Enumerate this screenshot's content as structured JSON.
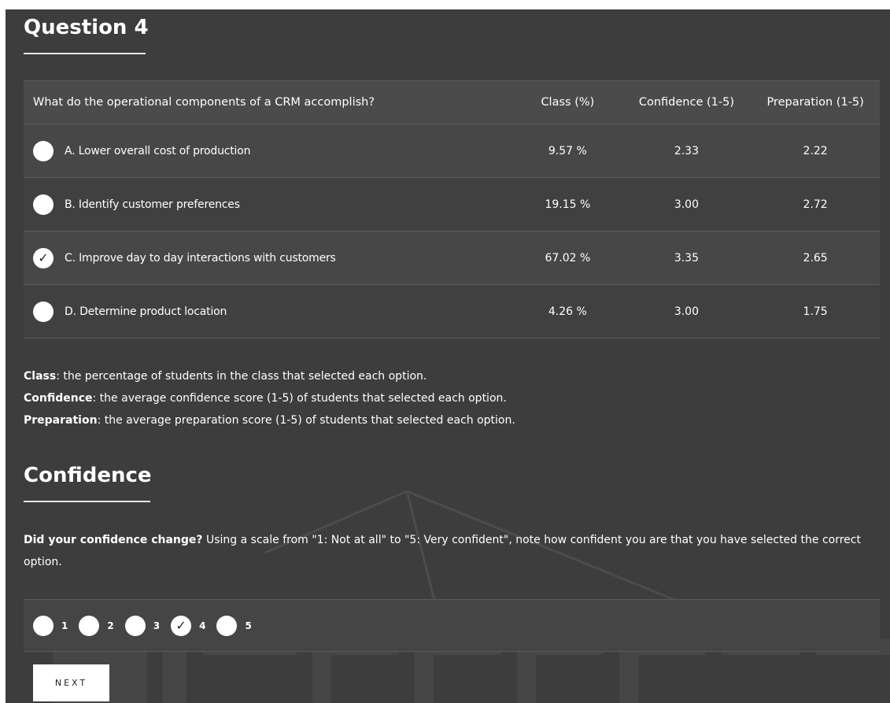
{
  "question": {
    "title": "Question 4",
    "text": "What do the operational components of a CRM accomplish?"
  },
  "table": {
    "columns": [
      "Class (%)",
      "Confidence (1-5)",
      "Preparation (1-5)"
    ],
    "rows": [
      {
        "label": "A. Lower overall cost of production",
        "class": "9.57 %",
        "confidence": "2.33",
        "preparation": "2.22",
        "selected": false
      },
      {
        "label": "B. Identify customer preferences",
        "class": "19.15 %",
        "confidence": "3.00",
        "preparation": "2.72",
        "selected": false
      },
      {
        "label": "C. Improve day to day interactions with customers",
        "class": "67.02 %",
        "confidence": "3.35",
        "preparation": "2.65",
        "selected": true
      },
      {
        "label": "D. Determine product location",
        "class": "4.26 %",
        "confidence": "3.00",
        "preparation": "1.75",
        "selected": false
      }
    ]
  },
  "legend": {
    "class_term": "Class",
    "class_desc": ": the percentage of students in the class that selected each option.",
    "confidence_term": "Confidence",
    "confidence_desc": ": the average confidence score (1-5) of students that selected each option.",
    "preparation_term": "Preparation",
    "preparation_desc": ": the average preparation score (1-5) of students that selected each option."
  },
  "confidence": {
    "title": "Confidence",
    "prompt_bold": "Did your confidence change?",
    "prompt_text": " Using a scale from \"1: Not at all\" to \"5: Very confident\", note how confident you are that you have selected the correct option.",
    "scale": [
      {
        "label": "1",
        "selected": false
      },
      {
        "label": "2",
        "selected": false
      },
      {
        "label": "3",
        "selected": false
      },
      {
        "label": "4",
        "selected": true
      },
      {
        "label": "5",
        "selected": false
      }
    ]
  },
  "next_button": "NEXT",
  "icons": {
    "checkmark": "check-icon",
    "radio": "radio-icon"
  },
  "colors": {
    "background": "#3d3d3d",
    "row_alt": "#474747",
    "text": "#ffffff",
    "radio_fill": "#ffffff"
  }
}
